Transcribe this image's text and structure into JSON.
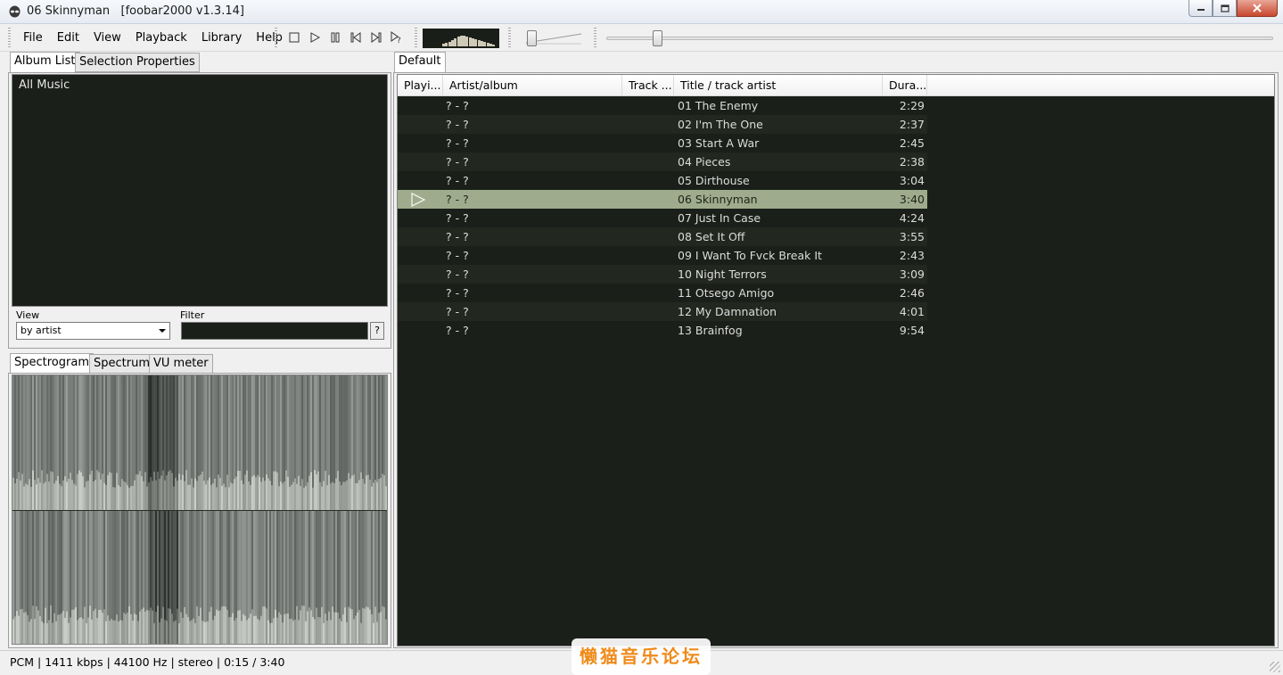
{
  "window": {
    "title": "06 Skinnyman   [foobar2000 v1.3.14]",
    "app_icon": "alien-icon",
    "buttons": [
      "minimize-icon",
      "maximize-icon",
      "close-icon"
    ]
  },
  "menu": [
    "File",
    "Edit",
    "View",
    "Playback",
    "Library",
    "Help"
  ],
  "transport": [
    "stop-icon",
    "play-icon",
    "pause-icon",
    "previous-icon",
    "next-icon",
    "random-icon"
  ],
  "volume_level": 0.05,
  "seek_position": 0.07,
  "left_tabs": {
    "album_list": "Album List",
    "selection_properties": "Selection Properties"
  },
  "album_list": {
    "root": "All Music"
  },
  "view_label": "View",
  "view_value": "by artist",
  "filter_label": "Filter",
  "filter_value": "",
  "filter_help": "?",
  "vis_tabs": {
    "spectrogram": "Spectrogram",
    "spectrum": "Spectrum",
    "vu_meter": "VU meter"
  },
  "playlist_tab": "Default",
  "columns": {
    "playing": "Playi...",
    "artist": "Artist/album",
    "track": "Track ...",
    "title": "Title / track artist",
    "duration": "Dura..."
  },
  "tracks": [
    {
      "artist": "? - ?",
      "title": "01 The Enemy",
      "duration": "2:29"
    },
    {
      "artist": "? - ?",
      "title": "02 I'm The One",
      "duration": "2:37"
    },
    {
      "artist": "? - ?",
      "title": "03 Start A War",
      "duration": "2:45"
    },
    {
      "artist": "? - ?",
      "title": "04 Pieces",
      "duration": "2:38"
    },
    {
      "artist": "? - ?",
      "title": "05 Dirthouse",
      "duration": "3:04"
    },
    {
      "artist": "? - ?",
      "title": "06 Skinnyman",
      "duration": "3:40",
      "playing": true
    },
    {
      "artist": "? - ?",
      "title": "07 Just In Case",
      "duration": "4:24"
    },
    {
      "artist": "? - ?",
      "title": "08 Set It Off",
      "duration": "3:55"
    },
    {
      "artist": "? - ?",
      "title": "09 I Want To Fvck Break It",
      "duration": "2:43"
    },
    {
      "artist": "? - ?",
      "title": "10 Night Terrors",
      "duration": "3:09"
    },
    {
      "artist": "? - ?",
      "title": "11 Otsego Amigo",
      "duration": "2:46"
    },
    {
      "artist": "? - ?",
      "title": "12 My Damnation",
      "duration": "4:01"
    },
    {
      "artist": "? - ?",
      "title": "13 Brainfog",
      "duration": "9:54"
    }
  ],
  "playing_icon": "play-arrow-icon",
  "status": "PCM | 1411 kbps | 44100 Hz | stereo | 0:15 / 3:40",
  "watermark": "懒猫音乐论坛",
  "colors": {
    "panel_bg": "#1b1f1a",
    "playing_row": "#9eac8d",
    "watermark": "#f08a19"
  }
}
